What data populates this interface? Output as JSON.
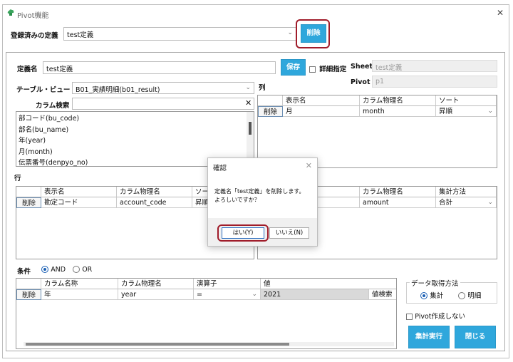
{
  "window": {
    "title": "Pivot機能",
    "close_glyph": "✕"
  },
  "top": {
    "registered_label": "登録済みの定義",
    "registered_value": "test定義",
    "delete_label": "削除"
  },
  "definition": {
    "name_label": "定義名",
    "name_value": "test定義",
    "save_label": "保存",
    "detail_label": "詳細指定",
    "sheet_label": "Sheet",
    "sheet_value": "test定義",
    "pivot_label": "Pivot",
    "pivot_value": "p1"
  },
  "table_view": {
    "label": "テーブル・ビュー",
    "value": "B01_実績明細(b01_result)"
  },
  "column_search": {
    "label": "カラム検索",
    "clear_glyph": "✕"
  },
  "column_list": [
    "部コード(bu_code)",
    "部名(bu_name)",
    "年(year)",
    "月(month)",
    "伝票番号(denpyo_no)"
  ],
  "columns_section": {
    "label": "列",
    "headers": [
      "表示名",
      "カラム物理名",
      "ソート"
    ],
    "rows": [
      {
        "delete": "削除",
        "display": "月",
        "physical": "month",
        "sort": "昇順"
      }
    ]
  },
  "rows_section": {
    "label": "行",
    "headers": [
      "表示名",
      "カラム物理名",
      "ソー"
    ],
    "rows": [
      {
        "delete": "削除",
        "display": "勘定コード",
        "physical": "account_code",
        "sort": "昇順"
      }
    ]
  },
  "values_section": {
    "headers": [
      "カラム物理名",
      "集計方法"
    ],
    "rows": [
      {
        "physical": "amount",
        "agg": "合計"
      }
    ]
  },
  "conditions": {
    "label": "条件",
    "and_label": "AND",
    "or_label": "OR",
    "selected": "AND",
    "headers": [
      "カラム名称",
      "カラム物理名",
      "演算子",
      "値"
    ],
    "rows": [
      {
        "delete": "削除",
        "name": "年",
        "physical": "year",
        "operator": "=",
        "value": "2021",
        "search": "値検索"
      }
    ]
  },
  "data_fetch": {
    "label": "データ取得方法",
    "summary_label": "集計",
    "detail_label": "明細",
    "selected": "集計"
  },
  "no_pivot_label": "Pivot作成しない",
  "run_label": "集計実行",
  "close_label": "閉じる",
  "dialog": {
    "title": "確認",
    "message_line1": "定義名「test定義」を削除します。",
    "message_line2": "よろしいですか？",
    "yes_label": "はい(Y)",
    "no_label": "いいえ(N)"
  },
  "colors": {
    "accent": "#2fa7dc",
    "highlight": "#a01c2a",
    "radio": "#1a5fb4"
  }
}
